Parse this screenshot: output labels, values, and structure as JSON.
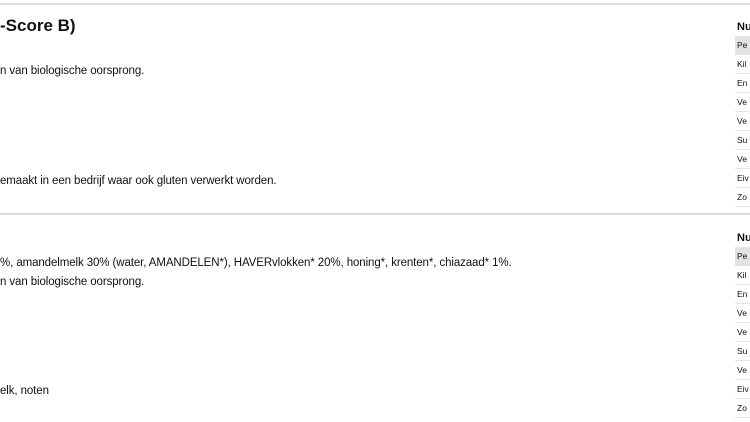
{
  "section1": {
    "title": "-Score B)",
    "line_origin": "n van biologische oorsprong.",
    "line_gluten": "emaakt in een bedrijf waar ook gluten verwerkt worden."
  },
  "section2": {
    "line_ingredients": "%, amandelmelk 30% (water, AMANDELEN*), HAVERvlokken* 20%, honing*, krenten*, chiazaad* 1%.",
    "line_origin": "n van biologische oorsprong.",
    "line_allergens": "elk, noten"
  },
  "panel1": {
    "header": "Nu",
    "rows": [
      "Pe",
      "Kil",
      "En",
      "Ve",
      "Ve",
      "Su",
      "Ve",
      "Eiv",
      "Zo"
    ]
  },
  "panel2": {
    "header": "Nu",
    "rows": [
      "Pe",
      "Kil",
      "En",
      "Ve",
      "Ve",
      "Su",
      "Ve",
      "Eiv",
      "Zo"
    ]
  }
}
